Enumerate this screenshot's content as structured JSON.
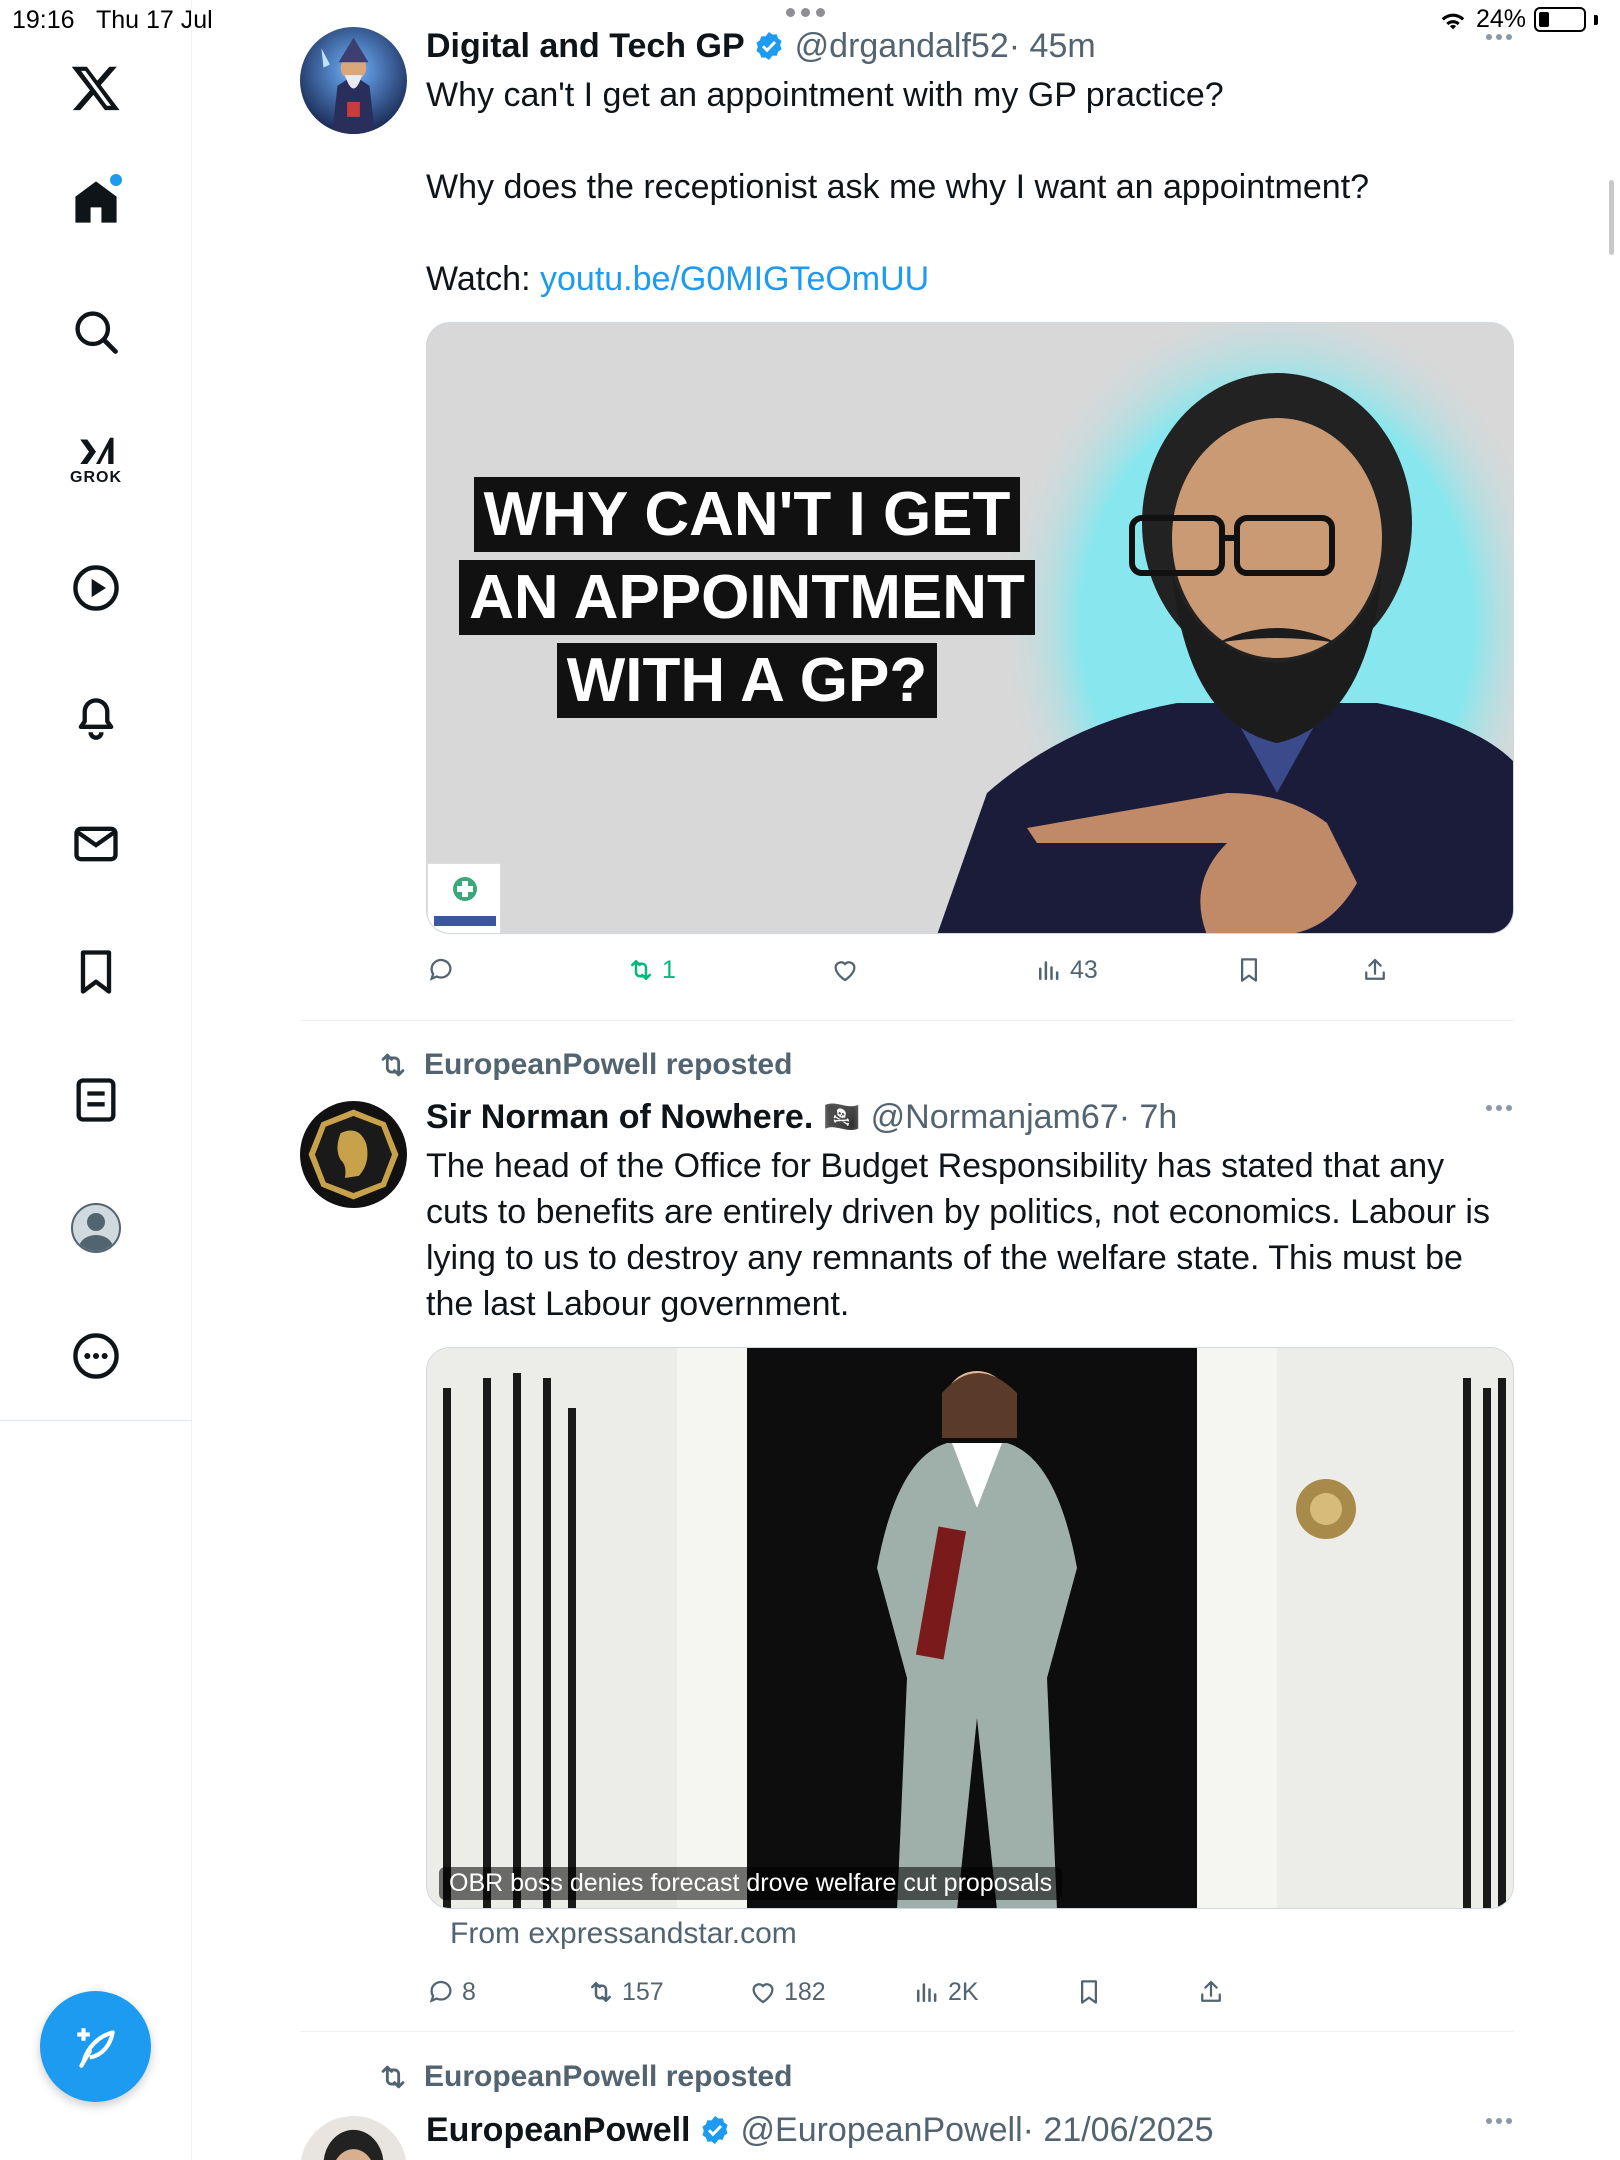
{
  "status_bar": {
    "time": "19:16",
    "date": "Thu 17 Jul",
    "battery": "24%",
    "battery_level": 0.24
  },
  "sidebar": {
    "grok_label": "GROK"
  },
  "tweets": [
    {
      "name": "Digital and Tech GP",
      "handle": "@drgandalf52",
      "time": "· 45m",
      "verified": true,
      "text_lines": [
        "Why can't I get an appointment with my GP practice?",
        "Why does the receptionist ask me why I want an appointment?",
        "Watch: "
      ],
      "link": "youtu.be/G0MIGTeOmUU",
      "thumbnail_text": [
        "WHY CAN'T I GET",
        "AN APPOINTMENT",
        "WITH A GP?"
      ],
      "actions": {
        "replies": "",
        "reposts": "1",
        "likes": "",
        "views": "43"
      }
    },
    {
      "reposted_by": "EuropeanPowell reposted",
      "name": "Sir Norman of Nowhere.",
      "name_emoji": "🏴‍☠️",
      "handle": "@Normanjam67",
      "time": "· 7h",
      "verified": false,
      "text": "The head of the Office for Budget Responsibility has stated that any cuts to benefits are entirely driven by politics, not economics. Labour is lying to us to destroy any remnants of the welfare state. This must be the last Labour government.",
      "card_caption": "OBR boss denies forecast drove welfare cut proposals",
      "card_source": "From expressandstar.com",
      "actions": {
        "replies": "8",
        "reposts": "157",
        "likes": "182",
        "views": "2K"
      }
    },
    {
      "reposted_by": "EuropeanPowell reposted",
      "name": "EuropeanPowell",
      "handle": "@EuropeanPowell",
      "time": "· 21/06/2025",
      "verified": true
    }
  ],
  "colors": {
    "accent": "#1d9bf0",
    "repost_green": "#00ba7c",
    "secondary_text": "#536471"
  }
}
